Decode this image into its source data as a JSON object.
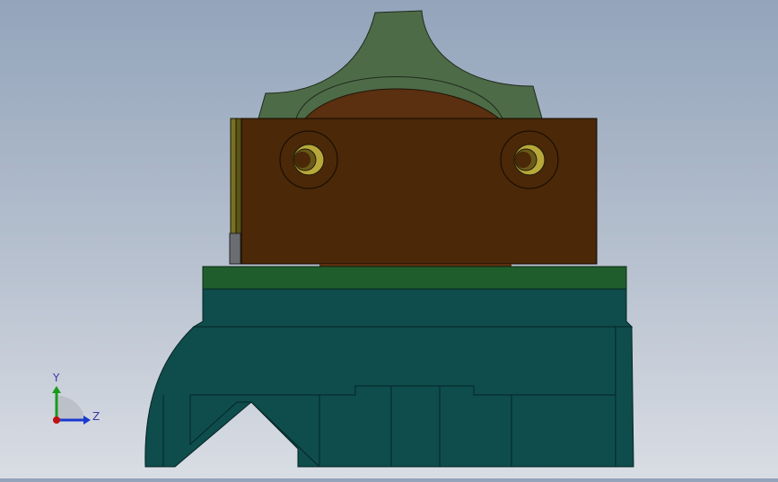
{
  "viewport": {
    "background_top": "#93a4bb",
    "background_bottom": "#d9dde4"
  },
  "triad": {
    "y_label": "Y",
    "z_label": "Z",
    "y_color": "#1a9a1a",
    "z_color": "#1a3ad0",
    "origin_color": "#c01010"
  },
  "colors": {
    "knob_green": "#4e6b47",
    "copper_block": "#4a2808",
    "copper_dome": "#5a3010",
    "plate_green": "#1f5e2c",
    "teal_body": "#0e4d4c",
    "teal_dark": "#0b3f3f",
    "bolt_gold": "#b8a73a"
  }
}
